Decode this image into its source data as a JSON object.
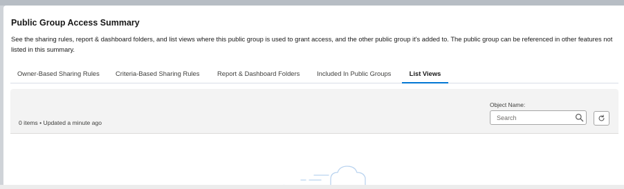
{
  "modal": {
    "title": "Public Group Access Summary",
    "description": "See the sharing rules, report & dashboard folders, and list views where this public group is used to grant access, and the other public group it's added to. The public group can be referenced in other features not listed in this summary."
  },
  "tabs": [
    {
      "label": "Owner-Based Sharing Rules",
      "active": false
    },
    {
      "label": "Criteria-Based Sharing Rules",
      "active": false
    },
    {
      "label": "Report & Dashboard Folders",
      "active": false
    },
    {
      "label": "Included In Public Groups",
      "active": false
    },
    {
      "label": "List Views",
      "active": true
    }
  ],
  "list_view": {
    "status": "0 items • Updated a minute ago",
    "object_filter": {
      "label": "Object Name:",
      "placeholder": "Search"
    },
    "icons": {
      "search": "search-icon",
      "refresh": "refresh-icon"
    }
  },
  "colors": {
    "accent": "#0176d3",
    "header_bg": "#f3f3f3",
    "border": "#dddbda"
  }
}
